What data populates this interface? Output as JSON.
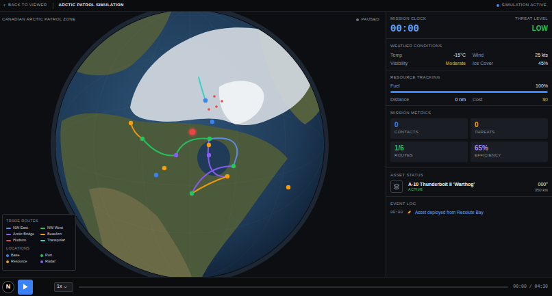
{
  "header": {
    "back_icon": "‹",
    "back": "BACK TO VIEWER",
    "title": "ARCTIC PATROL SIMULATION",
    "status": "SIMULATION ACTIVE"
  },
  "map": {
    "zone": "CANADIAN ARCTIC PATROL ZONE",
    "playback_state": "PAUSED",
    "routes": [
      {
        "color": "#2dd4bf"
      },
      {
        "color": "#f59e0b"
      },
      {
        "color": "#22c55e"
      },
      {
        "color": "#5b8def"
      },
      {
        "color": "#8b5cf6"
      },
      {
        "color": "#8b5cf6"
      },
      {
        "color": "#f59e0b"
      }
    ],
    "points": [
      {
        "kind": "base",
        "color": "#3b82f6"
      },
      {
        "kind": "base",
        "color": "#3b82f6"
      },
      {
        "kind": "base",
        "color": "#3b82f6"
      },
      {
        "kind": "resource",
        "color": "#f59e0b"
      },
      {
        "kind": "resource",
        "color": "#f59e0b"
      },
      {
        "kind": "resource",
        "color": "#f59e0b"
      },
      {
        "kind": "resource",
        "color": "#f59e0b"
      },
      {
        "kind": "resource",
        "color": "#f59e0b"
      },
      {
        "kind": "port",
        "color": "#22c55e"
      },
      {
        "kind": "port",
        "color": "#22c55e"
      },
      {
        "kind": "port",
        "color": "#22c55e"
      },
      {
        "kind": "port",
        "color": "#22c55e"
      },
      {
        "kind": "radar",
        "color": "#8b5cf6"
      },
      {
        "kind": "radar",
        "color": "#8b5cf6"
      },
      {
        "kind": "threat",
        "color": "#ef4444"
      },
      {
        "kind": "threat",
        "color": "#ef4444"
      },
      {
        "kind": "threat",
        "color": "#ef4444"
      },
      {
        "kind": "threat",
        "color": "#ef4444"
      },
      {
        "kind": "asset",
        "color": "#ef4444"
      }
    ]
  },
  "legend": {
    "routes_title": "TRADE ROUTES",
    "routes": [
      {
        "label": "NW East",
        "color": "#5b8def"
      },
      {
        "label": "NW West",
        "color": "#22c55e"
      },
      {
        "label": "Arctic Bridge",
        "color": "#8b5cf6"
      },
      {
        "label": "Beaufort",
        "color": "#f59e0b"
      },
      {
        "label": "Hudson",
        "color": "#ef4444"
      },
      {
        "label": "Transpolar",
        "color": "#2dd4bf"
      }
    ],
    "locations_title": "LOCATIONS",
    "locations": [
      {
        "label": "Base",
        "color": "#3b82f6"
      },
      {
        "label": "Port",
        "color": "#22c55e"
      },
      {
        "label": "Resource",
        "color": "#f59e0b"
      },
      {
        "label": "Radar",
        "color": "#8b5cf6"
      }
    ]
  },
  "controls": {
    "logo": "N",
    "speed": "1x",
    "time": "00:00 / 04:30",
    "level": 0
  },
  "panel": {
    "clock": {
      "label": "MISSION CLOCK",
      "value": "00:00"
    },
    "threat": {
      "label": "THREAT LEVEL",
      "value": "LOW"
    },
    "weather": {
      "title": "WEATHER CONDITIONS",
      "items": [
        {
          "label": "Temp",
          "value": "-15°C",
          "color": "#e5e7eb"
        },
        {
          "label": "Wind",
          "value": "25 kts",
          "color": "#e5e7eb"
        },
        {
          "label": "Visibility",
          "value": "Moderate",
          "color": "#eab308"
        },
        {
          "label": "Ice Cover",
          "value": "45%",
          "color": "#e5e7eb"
        }
      ]
    },
    "resources": {
      "title": "RESOURCE TRACKING",
      "fuel": {
        "label": "Fuel",
        "value": "100%",
        "level": 1
      },
      "items": [
        {
          "label": "Distance",
          "value": "0 nm",
          "color": "#e5e7eb"
        },
        {
          "label": "Cost",
          "value": "$0",
          "color": "#eab308"
        }
      ]
    },
    "metrics": {
      "title": "MISSION METRICS",
      "items": [
        {
          "value": "0",
          "label": "CONTACTS",
          "color": "#3b82f6"
        },
        {
          "value": "0",
          "label": "THREATS",
          "color": "#f59e0b"
        },
        {
          "value": "1/6",
          "label": "ROUTES",
          "color": "#22c55e"
        },
        {
          "value": "65%",
          "label": "EFFICIENCY",
          "color": "#a78bfa"
        }
      ]
    },
    "asset": {
      "title": "ASSET STATUS",
      "name": "A-10 Thunderbolt II 'Warthog'",
      "status": "ACTIVE",
      "heading": "000°",
      "speed": "350 kts"
    },
    "log": {
      "title": "EVENT LOG",
      "entries": [
        {
          "time": "00:00",
          "text": "Asset deployed from Resolute Bay"
        }
      ]
    }
  }
}
